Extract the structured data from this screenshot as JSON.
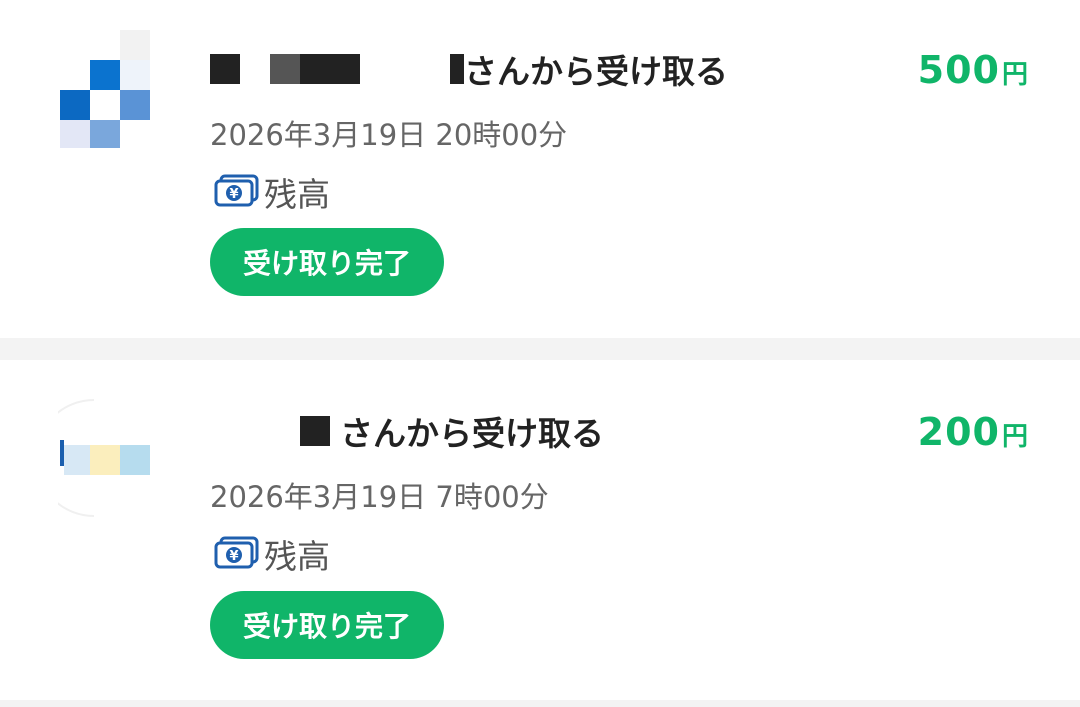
{
  "transactions": [
    {
      "sender_suffix": "さんから受け取る",
      "amount": "500",
      "currency": "円",
      "datetime": "2026年3月19日 20時00分",
      "method_icon": "yen-bill-icon",
      "method": "残高",
      "status": "受け取り完了"
    },
    {
      "sender_suffix": "さんから受け取る",
      "amount": "200",
      "currency": "円",
      "datetime": "2026年3月19日 7時00分",
      "method_icon": "yen-bill-icon",
      "method": "残高",
      "status": "受け取り完了"
    }
  ],
  "colors": {
    "accent_green": "#10b569",
    "text_primary": "#222222",
    "text_secondary": "#666666",
    "separator": "#f3f3f3",
    "icon_blue": "#1f5fae"
  }
}
